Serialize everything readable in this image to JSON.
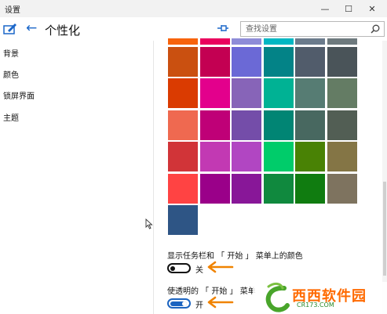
{
  "window": {
    "title": "设置",
    "minimize": "—",
    "maximize": "☐",
    "close": "✕"
  },
  "header": {
    "back_glyph": "←",
    "title": "个性化",
    "search_placeholder": "查找设置"
  },
  "sidebar": {
    "items": [
      {
        "label": "背景"
      },
      {
        "label": "颜色"
      },
      {
        "label": "锁屏界面"
      },
      {
        "label": "主题"
      }
    ]
  },
  "colors": {
    "accent": "#1c64c0",
    "swatch_rows": [
      [
        "#f7630c",
        "#ea005e",
        "#8e8cd8",
        "#00b7c3",
        "#6b7b8c",
        "#6e7a7e"
      ],
      [
        "#ca5010",
        "#c30052",
        "#6b69d6",
        "#038387",
        "#515c6b",
        "#4a5459"
      ],
      [
        "#da3b01",
        "#e3008c",
        "#8764b8",
        "#00b294",
        "#567c73",
        "#647c64"
      ],
      [
        "#ef6950",
        "#bf0077",
        "#744da9",
        "#018574",
        "#486860",
        "#525e54"
      ],
      [
        "#d13438",
        "#c239b3",
        "#b146c2",
        "#00cc6a",
        "#498205",
        "#847545"
      ],
      [
        "#ff4343",
        "#9a0089",
        "#881798",
        "#10893e",
        "#107c10",
        "#7e735f"
      ],
      [
        "#2e5585"
      ]
    ]
  },
  "settings": {
    "taskbar_color": {
      "label": "显示任务栏和 「 开始 」 菜单上的颜色",
      "state": "关",
      "on": false
    },
    "transparency": {
      "label": "使透明的 「 开始 」 菜单",
      "state": "开",
      "on": true
    }
  },
  "watermark": {
    "brand": "西西软件园",
    "url": "CR173.COM"
  }
}
